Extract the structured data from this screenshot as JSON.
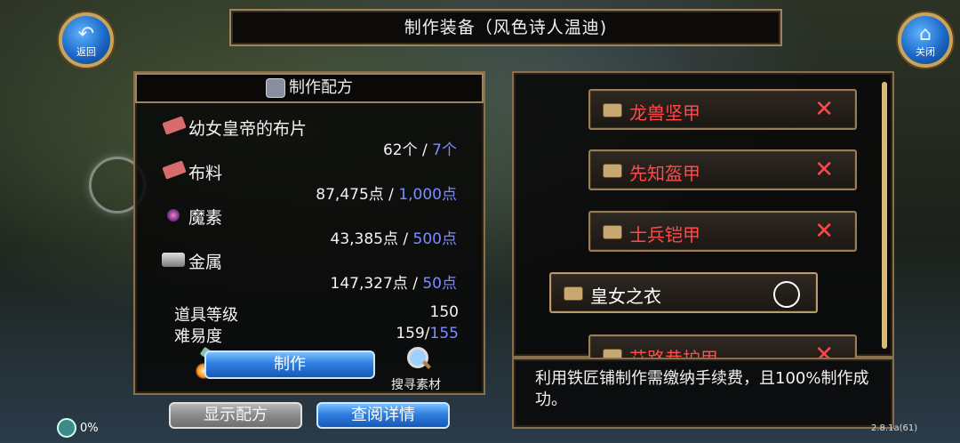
{
  "header": {
    "title": "制作装备（风色诗人温迪)",
    "back_label": "返回",
    "close_label": "关闭"
  },
  "recipe": {
    "title": "制作配方",
    "materials": [
      {
        "name": "幼女皇帝的布片",
        "have": "62个",
        "sep": " / ",
        "need": "7个",
        "icon": "cloth-scrap-icon"
      },
      {
        "name": "布料",
        "have": "87,475点",
        "sep": " / ",
        "need": "1,000点",
        "icon": "fabric-icon"
      },
      {
        "name": "魔素",
        "have": "43,385点",
        "sep": " / ",
        "need": "500点",
        "icon": "magic-orb-icon"
      },
      {
        "name": "金属",
        "have": "147,327点",
        "sep": " / ",
        "need": "50点",
        "icon": "metal-ingot-icon"
      }
    ],
    "item_level_label": "道具等级",
    "item_level_value": "150",
    "difficulty_label": "难易度",
    "difficulty_have": "159/",
    "difficulty_need": "155",
    "craft_button": "制作",
    "search_label": "搜寻素材"
  },
  "items": [
    {
      "name": "龙兽坚甲",
      "status": "x"
    },
    {
      "name": "先知盔甲",
      "status": "x"
    },
    {
      "name": "士兵铠甲",
      "status": "x"
    },
    {
      "name": "皇女之衣",
      "status": "o"
    },
    {
      "name": "艾路恭护甲",
      "status": "x"
    }
  ],
  "info_text": "利用铁匠铺制作需缴纳手续费，且100%制作成功。",
  "bottom": {
    "show_recipe": "显示配方",
    "view_details": "查阅详情",
    "percent": "0%",
    "version": "2.8.1a(61)"
  },
  "colors": {
    "frame": "#9b8460",
    "red_name": "#ff4a4a",
    "blue_value": "#7d8cff",
    "button_blue": "#2f7fe0"
  }
}
